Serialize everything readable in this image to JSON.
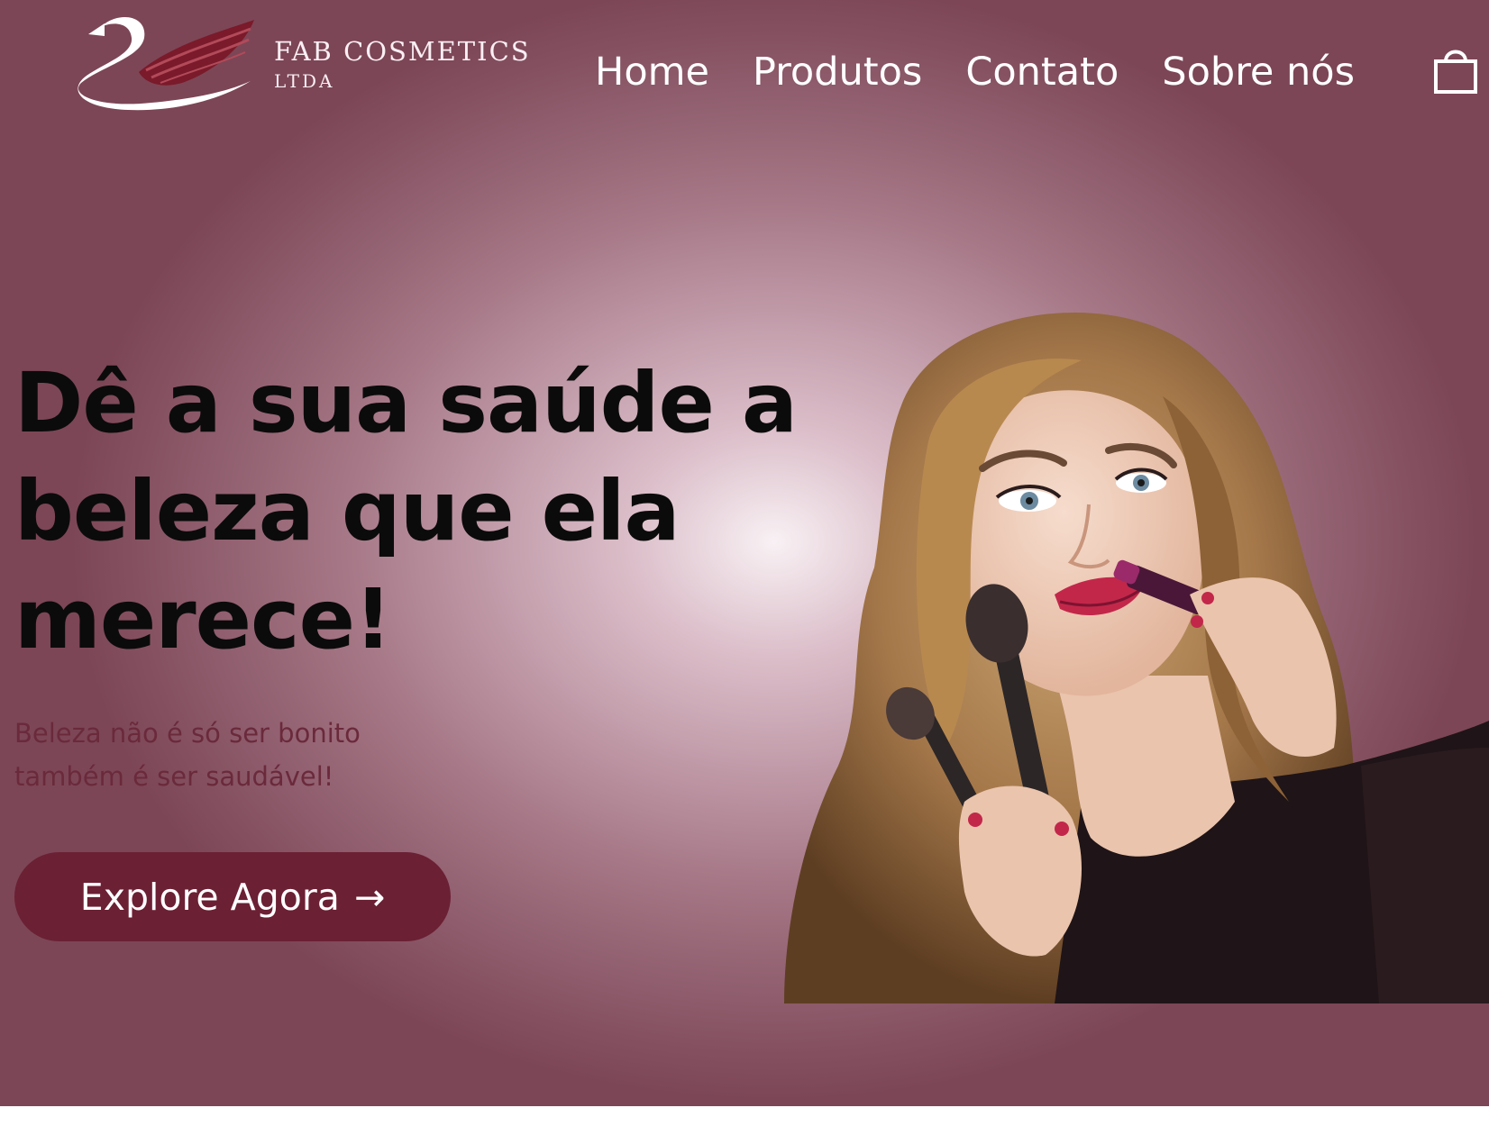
{
  "brand": {
    "name": "FAB COSMETICS",
    "suffix": "LTDA"
  },
  "nav": {
    "items": [
      "Home",
      "Produtos",
      "Contato",
      "Sobre nós"
    ],
    "cart_icon": "shopping-bag-icon"
  },
  "hero": {
    "headline": "Dê a sua saúde a beleza que ela merece!",
    "tagline": "Beleza não é só ser bonito também é ser saudável!",
    "cta_label": "Explore Agora",
    "cta_arrow": "→"
  },
  "colors": {
    "accent": "#6b2034",
    "tagline": "#6a2a3c",
    "headline": "#0b0b0b",
    "background_center": "#f8f1f4",
    "background_edge": "#7c4656",
    "logo_wing": "#7a1a2a"
  }
}
